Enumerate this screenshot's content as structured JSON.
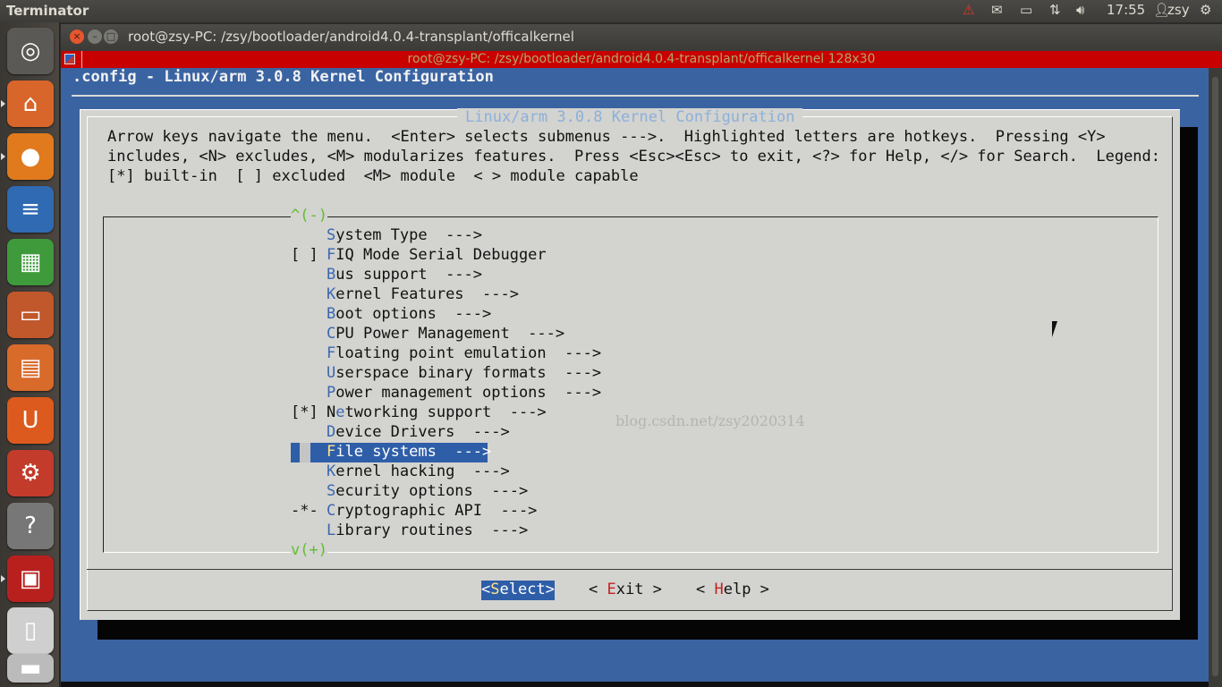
{
  "top_panel": {
    "app_name": "Terminator",
    "time": "17:55",
    "user": "zsy",
    "icons": [
      "warning-icon",
      "mail-icon",
      "battery-icon",
      "network-icon",
      "volume-icon",
      "user-icon",
      "gear-icon"
    ]
  },
  "launcher": {
    "items": [
      {
        "name": "dash-home",
        "glyph": "◎",
        "color": "#5a5955"
      },
      {
        "name": "home-folder",
        "glyph": "⌂",
        "color": "#d8652a"
      },
      {
        "name": "firefox",
        "glyph": "●",
        "color": "#e07a1c"
      },
      {
        "name": "libreoffice-writer",
        "glyph": "≡",
        "color": "#2f6ab3"
      },
      {
        "name": "libreoffice-calc",
        "glyph": "▦",
        "color": "#3f9a3c"
      },
      {
        "name": "libreoffice-impress",
        "glyph": "▭",
        "color": "#c0582b"
      },
      {
        "name": "software-center",
        "glyph": "▤",
        "color": "#d86a2a"
      },
      {
        "name": "ubuntu-one",
        "glyph": "U",
        "color": "#dd5a1e"
      },
      {
        "name": "system-settings",
        "glyph": "⚙",
        "color": "#c23b2b"
      },
      {
        "name": "help",
        "glyph": "?",
        "color": "#777777"
      },
      {
        "name": "terminator",
        "glyph": "▣",
        "color": "#b8201e"
      },
      {
        "name": "document-viewer",
        "glyph": "▯",
        "color": "#cfcfcf"
      },
      {
        "name": "scanner",
        "glyph": "▬",
        "color": "#bbbbbb"
      }
    ]
  },
  "window": {
    "title": "root@zsy-PC: /zsy/bootloader/android4.0.4-transplant/officalkernel",
    "terminal_title": "root@zsy-PC: /zsy/bootloader/android4.0.4-transplant/officalkernel 128x30"
  },
  "menuconfig": {
    "header": ".config - Linux/arm 3.0.8 Kernel Configuration",
    "dialog_title": "Linux/arm 3.0.8 Kernel Configuration",
    "help_lines": [
      "Arrow keys navigate the menu.  <Enter> selects submenus --->.  Highlighted letters are hotkeys.  Pressing <Y>",
      "includes, <N> excludes, <M> modularizes features.  Press <Esc><Esc> to exit, <?> for Help, </> for Search.  Legend:",
      "[*] built-in  [ ] excluded  <M> module  < > module capable"
    ],
    "scroll_up": "^(-)",
    "scroll_down": "v(+)",
    "items": [
      {
        "mark": "",
        "hot": "S",
        "rest": "ystem Type  --->",
        "selected": false
      },
      {
        "mark": "[ ]",
        "hot": "F",
        "rest": "IQ Mode Serial Debugger",
        "selected": false
      },
      {
        "mark": "",
        "hot": "B",
        "rest": "us support  --->",
        "selected": false
      },
      {
        "mark": "",
        "hot": "K",
        "rest": "ernel Features  --->",
        "selected": false
      },
      {
        "mark": "",
        "hot": "B",
        "rest": "oot options  --->",
        "selected": false
      },
      {
        "mark": "",
        "hot": "C",
        "rest": "PU Power Management  --->",
        "selected": false
      },
      {
        "mark": "",
        "hot": "F",
        "rest": "loating point emulation  --->",
        "selected": false
      },
      {
        "mark": "",
        "hot": "U",
        "rest": "serspace binary formats  --->",
        "selected": false
      },
      {
        "mark": "",
        "hot": "P",
        "rest": "ower management options  --->",
        "selected": false
      },
      {
        "mark": "[*]",
        "pre": "N",
        "hot": "e",
        "rest": "tworking support  --->",
        "selected": false
      },
      {
        "mark": "",
        "hot": "D",
        "rest": "evice Drivers  --->",
        "selected": false
      },
      {
        "mark": "",
        "hot": "F",
        "rest": "ile systems  --->",
        "selected": true
      },
      {
        "mark": "",
        "hot": "K",
        "rest": "ernel hacking  --->",
        "selected": false
      },
      {
        "mark": "",
        "hot": "S",
        "rest": "ecurity options  --->",
        "selected": false
      },
      {
        "mark": "-*-",
        "hot": "C",
        "rest": "ryptographic API  --->",
        "selected": false
      },
      {
        "mark": "",
        "hot": "L",
        "rest": "ibrary routines  --->",
        "selected": false
      }
    ],
    "buttons": {
      "select": {
        "open": "<",
        "hot": "S",
        "rest": "elect>"
      },
      "exit": {
        "open": "< ",
        "hot": "E",
        "rest": "xit >"
      },
      "help": {
        "open": "< ",
        "hot": "H",
        "rest": "elp >"
      }
    }
  },
  "watermark": "blog.csdn.net/zsy2020314"
}
